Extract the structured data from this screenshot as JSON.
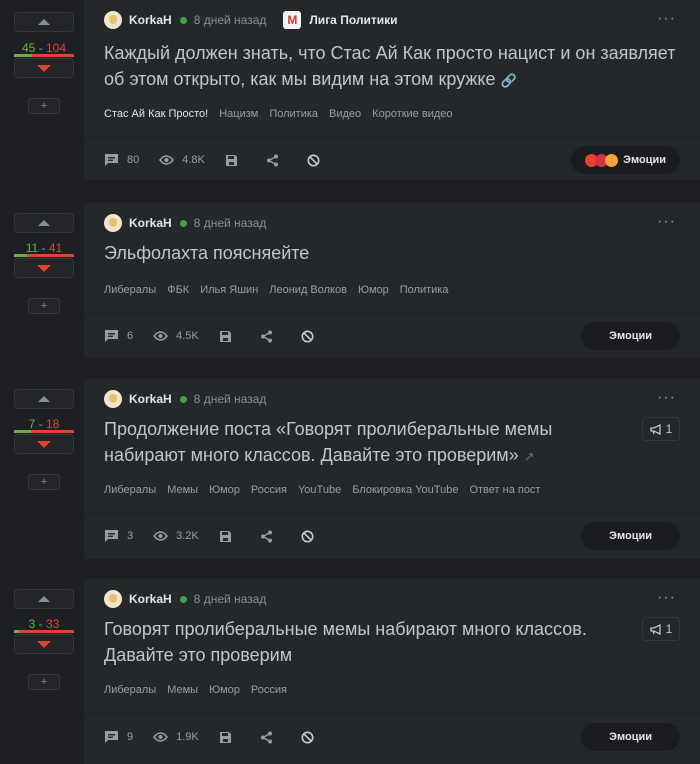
{
  "theme": {
    "background": "#1e2023",
    "card": "#25282b",
    "plus": "#6fae3e",
    "minus": "#e1442f",
    "online": "#3fa34d"
  },
  "icons": {
    "comments": "speech-bubble-icon",
    "views": "eye-icon",
    "save": "floppy-disk-icon",
    "share": "share-icon",
    "hide": "ban-icon",
    "menu": "more-dots-icon",
    "repost": "megaphone-icon"
  },
  "posts": [
    {
      "rating": {
        "plus": "45",
        "minus": "104",
        "sep": "-",
        "plus_ratio": 0.3,
        "more": "+"
      },
      "author": "KorkaH",
      "time": "8 дней назад",
      "community": "Лига Политики",
      "community_logo": "M",
      "menu": "···",
      "title": "Каждый должен знать, что Стас Ай Как просто нацист и он заявляет об этом открыто, как мы видим на этом кружке",
      "link_icon": "🔗",
      "tags": [
        "Стас Ай Как Просто!",
        "Нацизм",
        "Политика",
        "Видео",
        "Короткие видео"
      ],
      "comments": "80",
      "views": "4.8K",
      "emotions_label": "Эмоции"
    },
    {
      "rating": {
        "plus": "11",
        "minus": "41",
        "sep": "-",
        "plus_ratio": 0.21,
        "more": "+"
      },
      "author": "KorkaH",
      "time": "8 дней назад",
      "menu": "···",
      "title": "Эльфолахта поясняейте",
      "tags": [
        "Либералы",
        "ФБК",
        "Илья Яшин",
        "Леонид Волков",
        "Юмор",
        "Политика"
      ],
      "comments": "6",
      "views": "4.5K",
      "emotions_label": "Эмоции"
    },
    {
      "rating": {
        "plus": "7",
        "minus": "18",
        "sep": "-",
        "plus_ratio": 0.28,
        "more": "+"
      },
      "author": "KorkaH",
      "time": "8 дней назад",
      "menu": "···",
      "title_line1": "Продолжение поста «Говорят пролиберальные мемы",
      "title_line2": "набирают много классов. Давайте это проверим»",
      "ext_icon": "↗",
      "repost_count": "1",
      "tags": [
        "Либералы",
        "Мемы",
        "Юмор",
        "Россия",
        "YouTube",
        "Блокировка YouTube",
        "Ответ на пост"
      ],
      "comments": "3",
      "views": "3.2K",
      "emotions_label": "Эмоции"
    },
    {
      "rating": {
        "plus": "3",
        "minus": "33",
        "sep": "-",
        "plus_ratio": 0.08,
        "more": "+"
      },
      "author": "KorkaH",
      "time": "8 дней назад",
      "menu": "···",
      "title_line1": "Говорят пролиберальные мемы набирают много классов.",
      "title_line2": "Давайте это проверим",
      "repost_count": "1",
      "tags": [
        "Либералы",
        "Мемы",
        "Юмор",
        "Россия"
      ],
      "comments": "9",
      "views": "1.9K",
      "emotions_label": "Эмоции"
    }
  ]
}
